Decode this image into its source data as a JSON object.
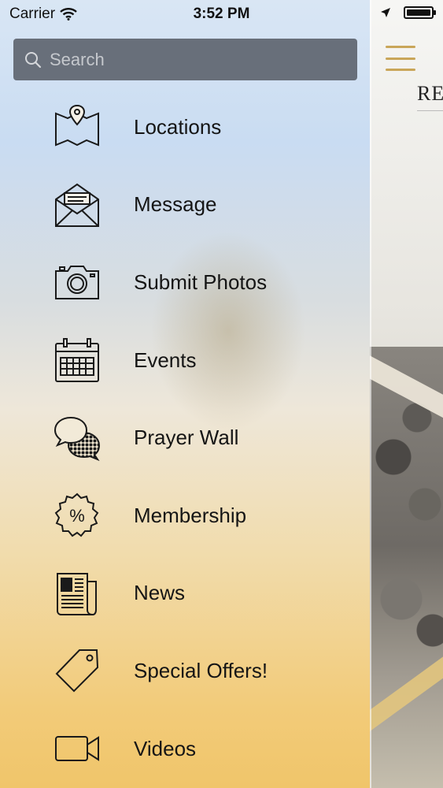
{
  "status_bar": {
    "carrier": "Carrier",
    "time": "3:52 PM"
  },
  "search": {
    "placeholder": "Search"
  },
  "menu": {
    "items": [
      {
        "label": "Locations",
        "icon": "map-pin-icon"
      },
      {
        "label": "Message",
        "icon": "envelope-icon"
      },
      {
        "label": "Submit Photos",
        "icon": "camera-icon"
      },
      {
        "label": "Events",
        "icon": "calendar-icon"
      },
      {
        "label": "Prayer Wall",
        "icon": "chat-bubbles-icon"
      },
      {
        "label": "Membership",
        "icon": "percent-badge-icon"
      },
      {
        "label": "News",
        "icon": "newspaper-icon"
      },
      {
        "label": "Special Offers!",
        "icon": "tag-icon"
      },
      {
        "label": "Videos",
        "icon": "video-camera-icon"
      }
    ]
  },
  "main_screen": {
    "brand_text": "RE"
  },
  "colors": {
    "accent_gold": "#c9a659",
    "search_bg": "#50555f"
  }
}
